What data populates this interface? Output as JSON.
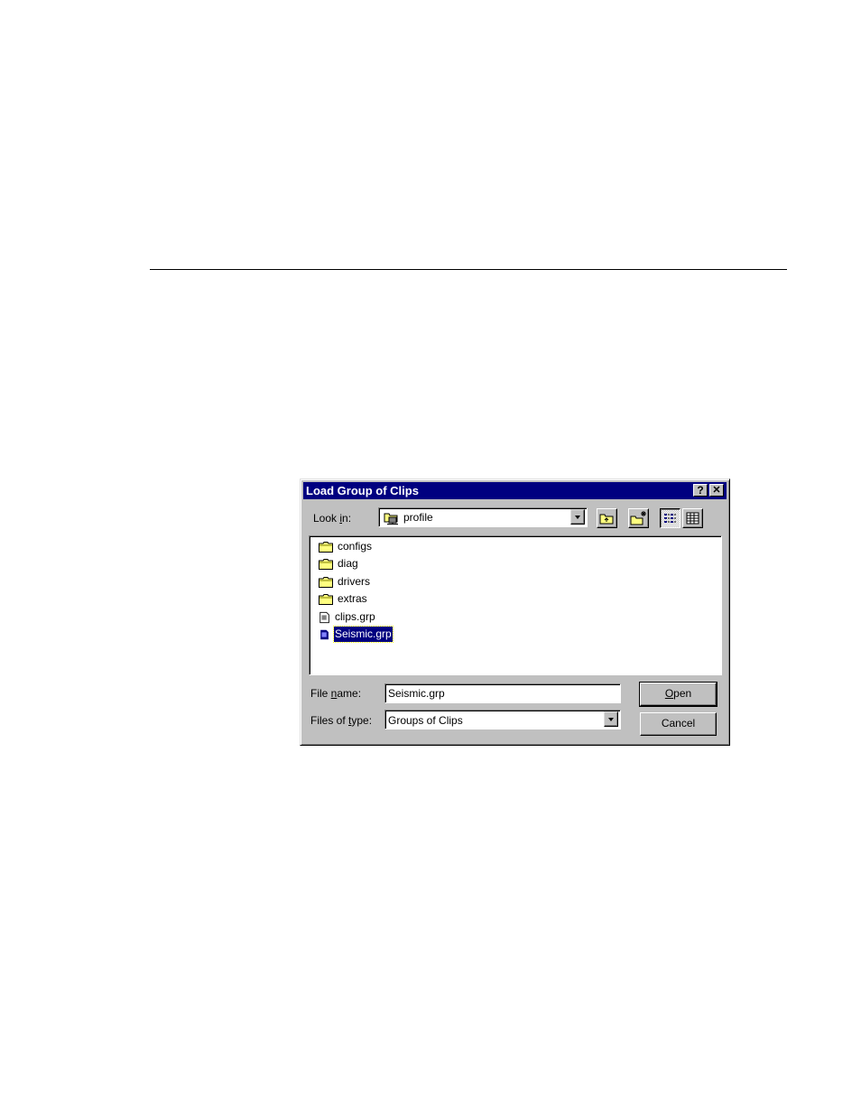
{
  "dialog": {
    "title": "Load Group of Clips",
    "help_btn": "?",
    "close_btn": "✕"
  },
  "look_in": {
    "label_pre": "Look ",
    "label_key": "i",
    "label_post": "n:",
    "value": "profile"
  },
  "files": [
    {
      "name": "configs",
      "type": "folder",
      "selected": false
    },
    {
      "name": "diag",
      "type": "folder",
      "selected": false
    },
    {
      "name": "drivers",
      "type": "folder",
      "selected": false
    },
    {
      "name": "extras",
      "type": "folder",
      "selected": false
    },
    {
      "name": "clips.grp",
      "type": "file",
      "selected": false
    },
    {
      "name": "Seismic.grp",
      "type": "file",
      "selected": true
    }
  ],
  "file_name": {
    "label_pre": "File ",
    "label_key": "n",
    "label_post": "ame:",
    "value": "Seismic.grp"
  },
  "file_type": {
    "label_pre": "Files of ",
    "label_key": "t",
    "label_post": "ype:",
    "value": "Groups of Clips"
  },
  "buttons": {
    "open_key": "O",
    "open_rest": "pen",
    "cancel": "Cancel"
  },
  "colors": {
    "title_bar": "#000080",
    "selection": "#000080",
    "face": "#c0c0c0"
  }
}
